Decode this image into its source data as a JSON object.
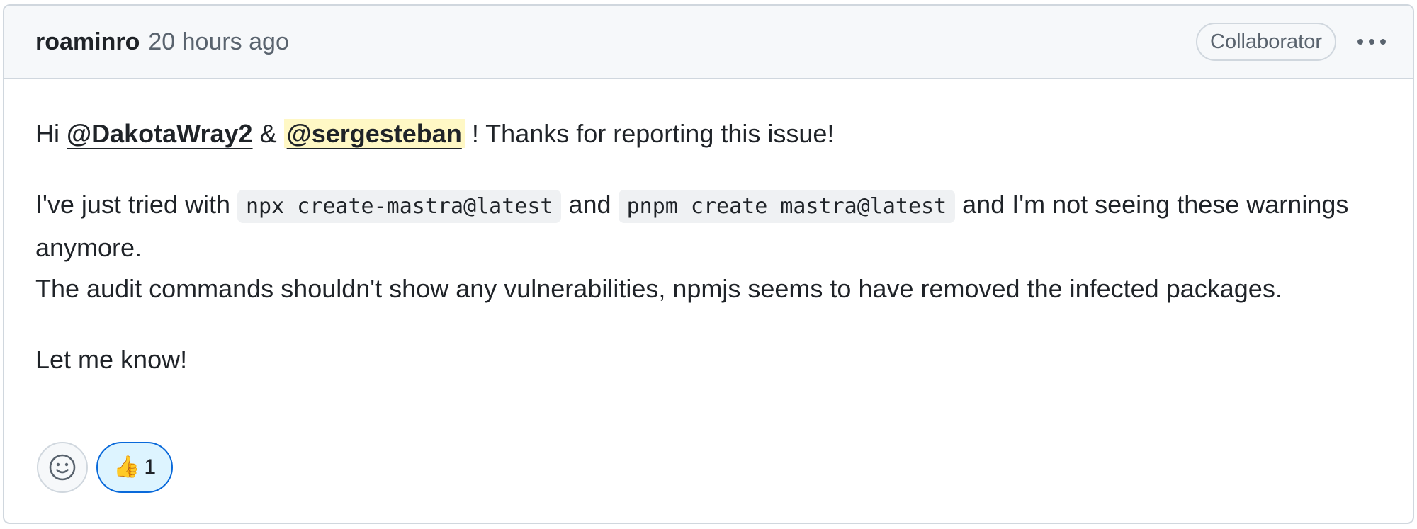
{
  "comment": {
    "author": "roaminro",
    "timestamp": "20 hours ago",
    "badge": "Collaborator",
    "body": {
      "p1": {
        "greeting": "Hi",
        "mention1": "@DakotaWray2",
        "amp": "&",
        "mention2": "@sergesteban",
        "rest": "! Thanks for reporting this issue!"
      },
      "p2": {
        "text1": "I've just tried with",
        "code1": "npx create-mastra@latest",
        "and": "and",
        "code2": "pnpm create mastra@latest",
        "text2": "and I'm not seeing these warnings anymore.",
        "line2": "The audit commands shouldn't show any vulnerabilities, npmjs seems to have removed the infected packages."
      },
      "p3": "Let me know!"
    },
    "reactions": {
      "add_icon": "smiley-icon",
      "items": [
        {
          "emoji": "👍",
          "icon": "thumbs-up-icon",
          "count": "1"
        }
      ]
    }
  },
  "colors": {
    "border": "#d0d7de",
    "header_bg": "#f6f8fa",
    "mention_highlight": "#fff8c5",
    "reaction_active_border": "#0969da",
    "reaction_active_bg": "#ddf4ff"
  }
}
